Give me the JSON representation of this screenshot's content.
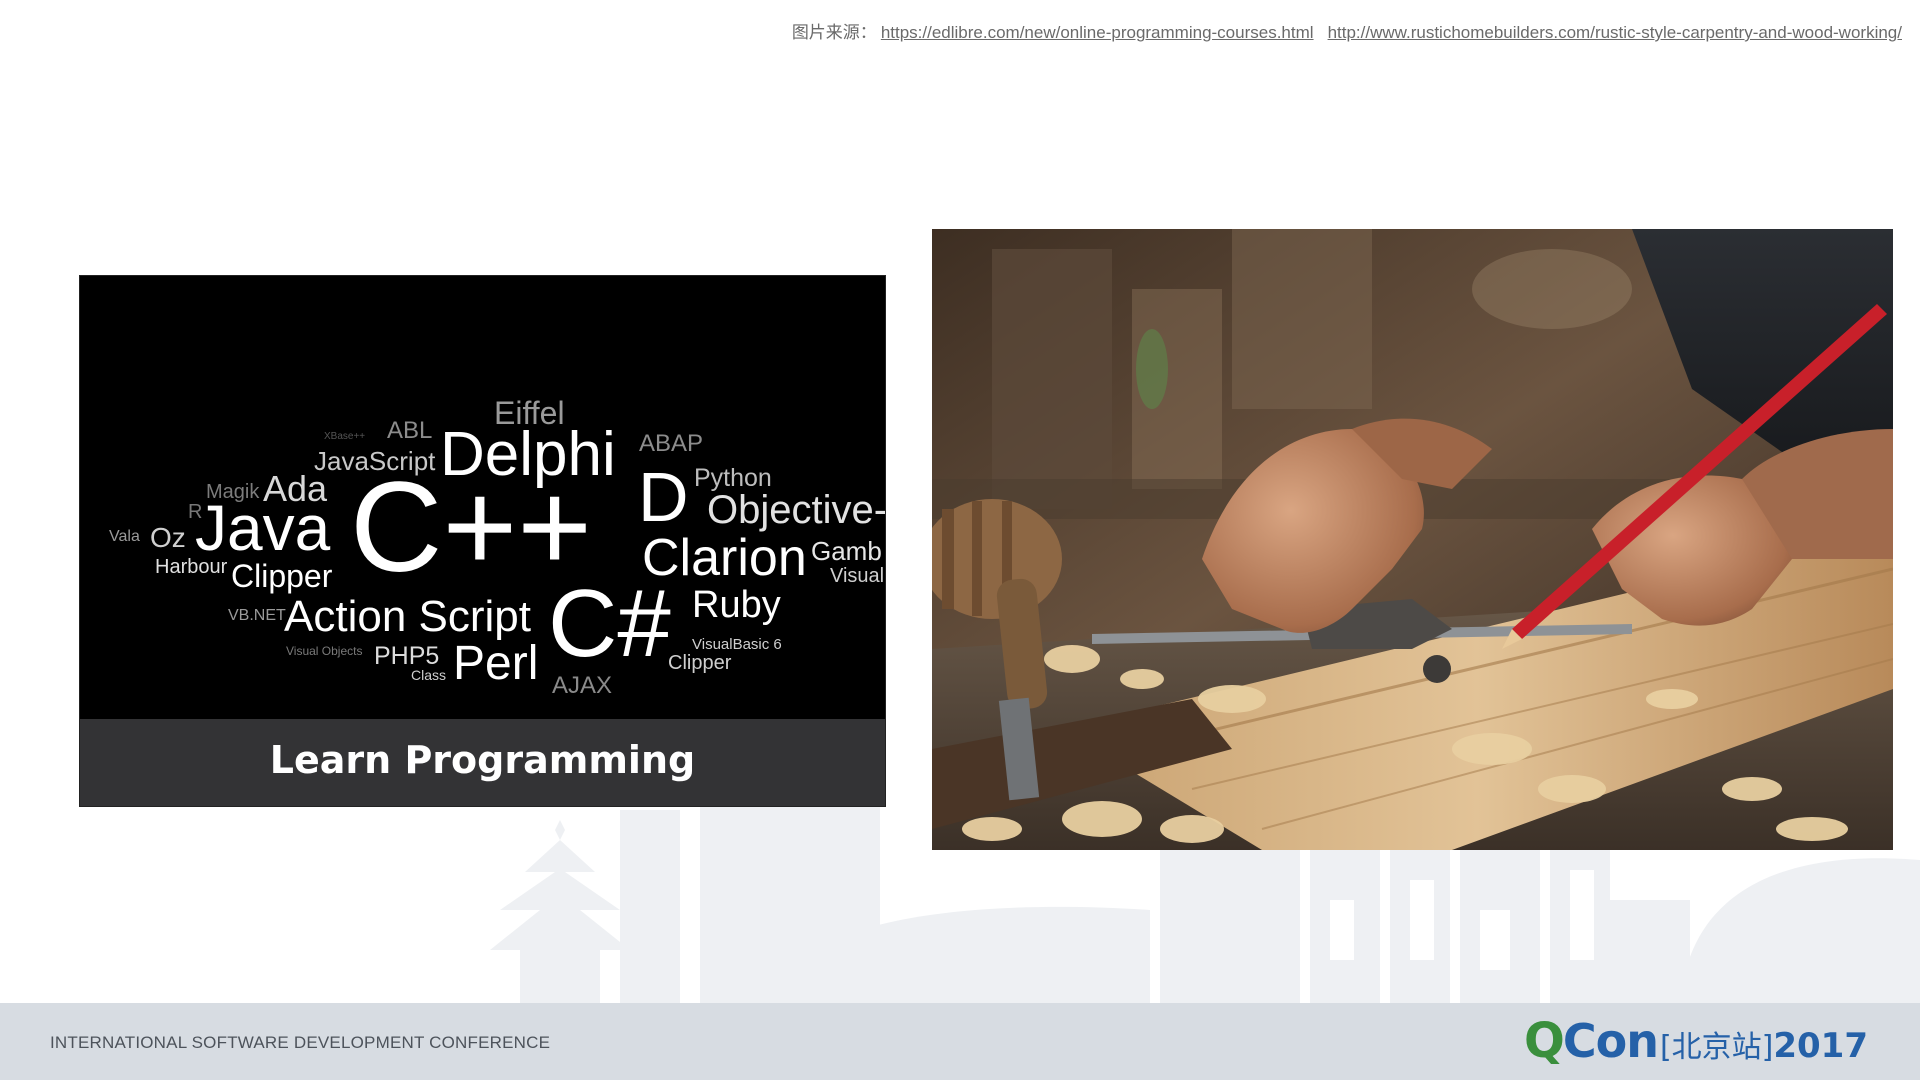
{
  "source": {
    "prefix": "图片来源：",
    "link1": "https://edlibre.com/new/online-programming-courses.html",
    "link2": "http://www.rustichomebuilders.com/rustic-style-carpentry-and-wood-working/"
  },
  "left_image": {
    "caption": "Learn Programming",
    "words": {
      "xbase": "XBase++",
      "abl": "ABL",
      "eiffel": "Eiffel",
      "abap": "ABAP",
      "javascript": "JavaScript",
      "delphi": "Delphi",
      "python": "Python",
      "magik": "Magik",
      "ada": "Ada",
      "d": "D",
      "objective": "Objective-",
      "r": "R",
      "vala": "Vala",
      "oz": "Oz",
      "java": "Java",
      "cpp": "C++",
      "clarion": "Clarion",
      "gamb": "Gamb",
      "harbour": "Harbour",
      "clipper": "Clipper",
      "visual": "Visual",
      "vbnet": "VB.NET",
      "actionscript": "Action Script",
      "csharp": "C#",
      "ruby": "Ruby",
      "visualobjects": "Visual Objects",
      "php5": "PHP5",
      "class": "Class",
      "perl": "Perl",
      "visualbasic": "VisualBasic 6",
      "clipper2": "Clipper",
      "ajax": "AJAX"
    }
  },
  "footer": {
    "conference": "INTERNATIONAL SOFTWARE DEVELOPMENT CONFERENCE",
    "logo_q": "Q",
    "logo_con": "Con",
    "logo_city": "[北京站]",
    "logo_year": "2017"
  },
  "colors": {
    "logo_green": "#3a8f3d",
    "logo_blue": "#2561a8",
    "footer_bg": "#d7dce2",
    "caption_bg": "#333335"
  }
}
